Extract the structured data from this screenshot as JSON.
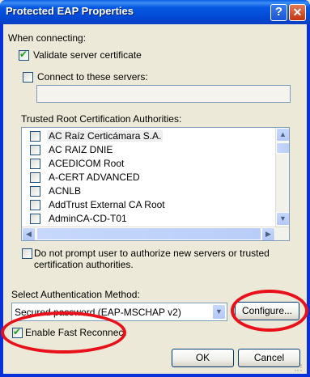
{
  "window": {
    "title": "Protected EAP Properties",
    "help_glyph": "?",
    "close_glyph": "✕"
  },
  "connecting": {
    "label": "When connecting:",
    "validate_label": "Validate server certificate",
    "validate_checked": true,
    "connect_servers_label": "Connect to these servers:",
    "connect_servers_checked": false,
    "servers_value": ""
  },
  "trusted": {
    "label": "Trusted Root Certification Authorities:",
    "items": [
      {
        "label": "AC Raíz Certicámara S.A.",
        "checked": false
      },
      {
        "label": "AC RAIZ DNIE",
        "checked": false
      },
      {
        "label": "ACEDICOM Root",
        "checked": false
      },
      {
        "label": "A-CERT ADVANCED",
        "checked": false
      },
      {
        "label": "ACNLB",
        "checked": false
      },
      {
        "label": "AddTrust External CA Root",
        "checked": false
      },
      {
        "label": "AdminCA-CD-T01",
        "checked": false
      }
    ],
    "scroll_up": "▲",
    "scroll_down": "▼",
    "scroll_left": "◀",
    "scroll_right": "▶"
  },
  "prompt": {
    "label_line1": "Do not prompt user to authorize new servers or trusted",
    "label_line2": "certification authorities.",
    "checked": false
  },
  "auth": {
    "label": "Select Authentication Method:",
    "selected": "Secured password (EAP-MSCHAP v2)",
    "dropdown_arrow": "▼",
    "configure_label": "Configure...",
    "fast_reconnect_label": "Enable Fast Reconnect",
    "fast_reconnect_checked": true
  },
  "footer": {
    "ok_label": "OK",
    "cancel_label": "Cancel"
  },
  "colors": {
    "titlebar": "#0558e1",
    "annotation": "#e8101a",
    "dialog_bg": "#ece9d8"
  }
}
